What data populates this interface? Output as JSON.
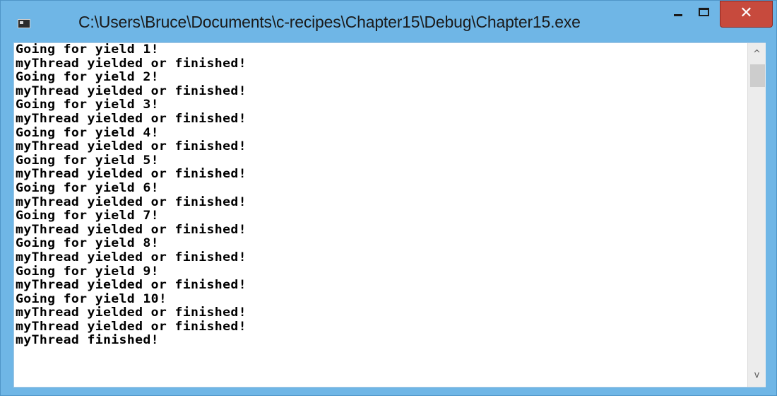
{
  "window": {
    "title": "C:\\Users\\Bruce\\Documents\\c-recipes\\Chapter15\\Debug\\Chapter15.exe",
    "close_symbol": "✕",
    "icon_names": {
      "app": "console-app-icon",
      "minimize": "minimize-icon",
      "maximize": "maximize-icon",
      "close": "close-icon"
    },
    "colors": {
      "frame": "#6fb6e6",
      "close_button": "#c74a3d"
    }
  },
  "console": {
    "lines": [
      "Going for yield 1!",
      "myThread yielded or finished!",
      "Going for yield 2!",
      "myThread yielded or finished!",
      "Going for yield 3!",
      "myThread yielded or finished!",
      "Going for yield 4!",
      "myThread yielded or finished!",
      "Going for yield 5!",
      "myThread yielded or finished!",
      "Going for yield 6!",
      "myThread yielded or finished!",
      "Going for yield 7!",
      "myThread yielded or finished!",
      "Going for yield 8!",
      "myThread yielded or finished!",
      "Going for yield 9!",
      "myThread yielded or finished!",
      "Going for yield 10!",
      "myThread yielded or finished!",
      "myThread yielded or finished!",
      "myThread finished!"
    ]
  },
  "scrollbar": {
    "up_arrow": "^",
    "down_arrow": "v",
    "icon_names": {
      "up": "scroll-up-arrow-icon",
      "down": "scroll-down-arrow-icon"
    }
  }
}
